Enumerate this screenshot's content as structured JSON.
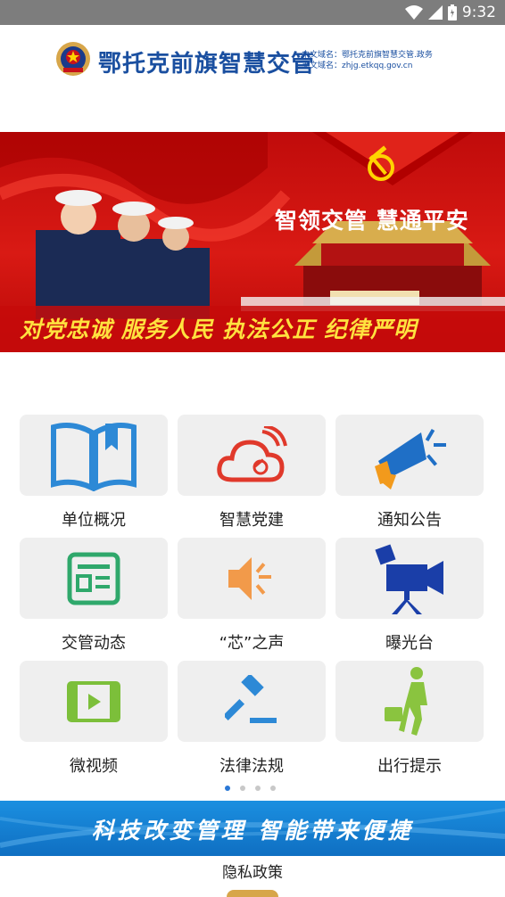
{
  "status_bar": {
    "time": "9:32",
    "icons": [
      "wifi-icon",
      "signal-icon",
      "battery-icon"
    ]
  },
  "header": {
    "app_title": "鄂托克前旗智慧交管",
    "cn_domain": "中文域名：鄂托克前旗智慧交管.政务",
    "en_domain": "英文域名：zhjg.etkqq.gov.cn"
  },
  "banner": {
    "slogan_top": "智领交管  慧通平安",
    "slogan_bottom": "对党忠诚 服务人民 执法公正 纪律严明",
    "colors": {
      "primary": "#d91a14",
      "accent": "#ffe23f"
    }
  },
  "grid": {
    "items": [
      {
        "label": "单位概况",
        "icon": "book-icon"
      },
      {
        "label": "智慧党建",
        "icon": "party-cloud-icon"
      },
      {
        "label": "通知公告",
        "icon": "megaphone-icon"
      },
      {
        "label": "交管动态",
        "icon": "news-icon"
      },
      {
        "label": "“芯”之声",
        "icon": "speaker-icon"
      },
      {
        "label": "曝光台",
        "icon": "camera-icon"
      },
      {
        "label": "微视频",
        "icon": "video-icon"
      },
      {
        "label": "法律法规",
        "icon": "gavel-icon"
      },
      {
        "label": "出行提示",
        "icon": "traveler-icon"
      }
    ]
  },
  "pager": {
    "count": 4,
    "active": 1
  },
  "bottom_banner": {
    "slogan": "科技改变管理  智能带来便捷"
  },
  "footer": {
    "privacy_link": "隐私政策"
  }
}
